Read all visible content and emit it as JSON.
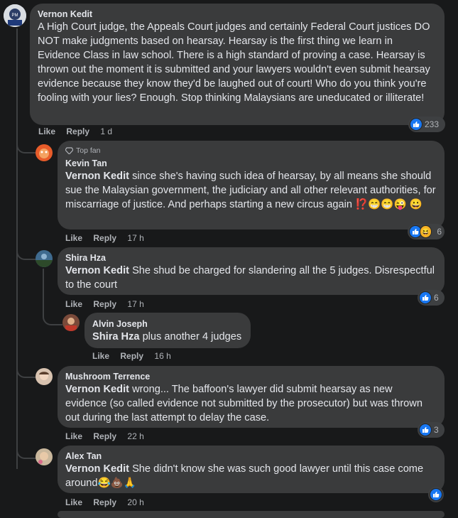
{
  "comments": [
    {
      "author": "Vernon Kedit",
      "text": "A High Court judge, the Appeals Court judges and certainly Federal Court justices DO NOT make judgments based on hearsay. Hearsay is the first thing we learn in Evidence Class in law school. There is a high standard of proving a case. Hearsay is thrown out the moment it is submitted and your lawyers wouldn't even submit hearsay evidence because they know they'd be laughed out of court! Who do you think you're fooling with your lies? Enough. Stop thinking Malaysians are uneducated or illiterate!",
      "like": "Like",
      "reply": "Reply",
      "time": "1 d",
      "reactions": "233"
    },
    {
      "badge": "Top fan",
      "author": "Kevin Tan",
      "mention": "Vernon Kedit",
      "text": " since she's having such idea of hearsay, by all means she should sue the Malaysian government, the judiciary and all other relevant authorities, for miscarriage of justice. And perhaps starting a new circus again ⁉️😁😁😜 😀",
      "like": "Like",
      "reply": "Reply",
      "time": "17 h",
      "reactions": "6"
    },
    {
      "author": "Shira Hza",
      "mention": "Vernon Kedit",
      "text": " She shud be charged for slandering all the 5 judges. Disrespectful to the court",
      "like": "Like",
      "reply": "Reply",
      "time": "17 h",
      "reactions": "6"
    },
    {
      "author": "Alvin Joseph",
      "mention": "Shira Hza",
      "text": " plus another 4 judges",
      "like": "Like",
      "reply": "Reply",
      "time": "16 h"
    },
    {
      "author": "Mushroom Terrence",
      "mention": "Vernon Kedit",
      "text": " wrong... The baffoon's lawyer did submit hearsay as new evidence (so called evidence not submitted by the prosecutor) but was thrown out during the last attempt to delay the case.",
      "like": "Like",
      "reply": "Reply",
      "time": "22 h",
      "reactions": "3"
    },
    {
      "author": "Alex Tan",
      "mention": "Vernon Kedit",
      "text": " She didn't know she was such good lawyer until this case come around😂💩🙏",
      "like": "Like",
      "reply": "Reply",
      "time": "20 h"
    }
  ]
}
